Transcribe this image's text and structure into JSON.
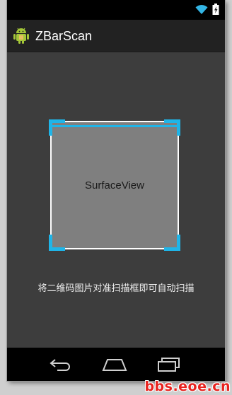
{
  "app": {
    "title": "ZBarScan",
    "icon": "android-icon"
  },
  "status_bar": {
    "icons": [
      "wifi-icon",
      "battery-icon"
    ],
    "accent": "#33b5e5"
  },
  "scanner": {
    "surface_label": "SurfaceView",
    "frame_color": "#ffffff",
    "corner_color": "#1fb5e8",
    "surface_color": "#7f7f7f"
  },
  "hint": {
    "text": "将二维码图片对准扫描框即可自动扫描"
  },
  "nav_bar": {
    "buttons": [
      "back-icon",
      "home-icon",
      "recent-apps-icon"
    ]
  },
  "watermark": {
    "text": "bbs.eoe.cn"
  },
  "colors": {
    "background": "#3d3d3d",
    "action_bar": "#222222",
    "status_bar": "#000000"
  }
}
